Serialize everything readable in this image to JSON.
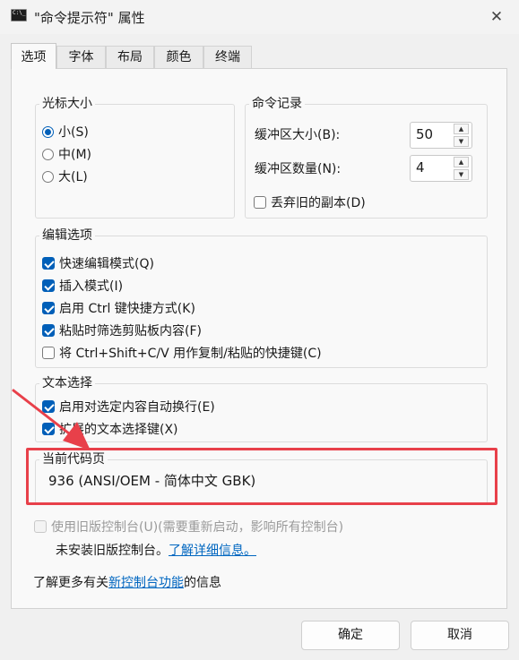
{
  "window": {
    "title": "\"命令提示符\" 属性",
    "app_icon_text": "C:\\_",
    "close_glyph": "✕"
  },
  "tabs": [
    {
      "label": "选项",
      "active": true
    },
    {
      "label": "字体"
    },
    {
      "label": "布局"
    },
    {
      "label": "颜色"
    },
    {
      "label": "终端"
    }
  ],
  "cursor_size": {
    "label": "光标大小",
    "options": [
      {
        "label": "小(S)",
        "selected": true
      },
      {
        "label": "中(M)",
        "selected": false
      },
      {
        "label": "大(L)",
        "selected": false
      }
    ]
  },
  "history": {
    "label": "命令记录",
    "buffer_size_label": "缓冲区大小(B):",
    "buffer_size_value": "50",
    "buffer_count_label": "缓冲区数量(N):",
    "buffer_count_value": "4",
    "discard_label": "丢弃旧的副本(D)",
    "discard_checked": false,
    "spin_up": "▲",
    "spin_down": "▼"
  },
  "edit_options": {
    "label": "编辑选项",
    "items": [
      {
        "label": "快速编辑模式(Q)",
        "checked": true
      },
      {
        "label": "插入模式(I)",
        "checked": true
      },
      {
        "label": "启用 Ctrl 键快捷方式(K)",
        "checked": true
      },
      {
        "label": "粘贴时筛选剪贴板内容(F)",
        "checked": true
      },
      {
        "label": "将 Ctrl+Shift+C/V 用作复制/粘贴的快捷键(C)",
        "checked": false
      }
    ]
  },
  "text_selection": {
    "label": "文本选择",
    "items": [
      {
        "label": "启用对选定内容自动换行(E)",
        "checked": true
      },
      {
        "label": "扩展的文本选择键(X)",
        "checked": true
      }
    ]
  },
  "codepage": {
    "label": "当前代码页",
    "value": "936   (ANSI/OEM - 简体中文 GBK)"
  },
  "legacy": {
    "label": "使用旧版控制台(U)(需要重新启动，影响所有控制台)",
    "checked": false,
    "not_installed_text": "未安装旧版控制台。",
    "learn_more_link": "了解详细信息。"
  },
  "more_info": {
    "prefix": "了解更多有关",
    "link": "新控制台功能",
    "suffix": "的信息"
  },
  "buttons": {
    "ok": "确定",
    "cancel": "取消"
  },
  "colors": {
    "accent": "#005fb8",
    "highlight": "#e8404a",
    "link": "#0066c0"
  }
}
